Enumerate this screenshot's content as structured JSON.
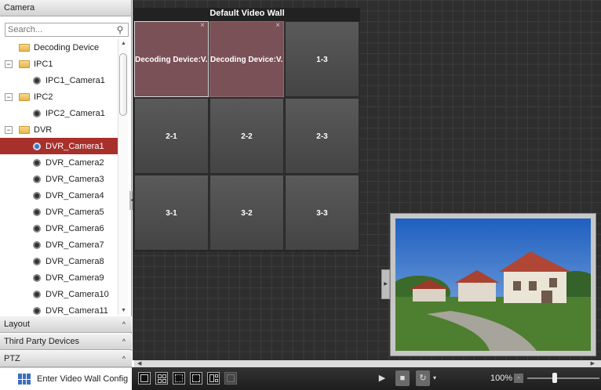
{
  "sidebar": {
    "camera_header": "Camera",
    "search": {
      "placeholder": "Search..."
    },
    "tree": [
      {
        "label": "Decoding Device",
        "kind": "folder",
        "expander": ""
      },
      {
        "label": "IPC1",
        "kind": "folder",
        "expander": "−"
      },
      {
        "label": "IPC1_Camera1",
        "kind": "camera",
        "expander": ""
      },
      {
        "label": "IPC2",
        "kind": "folder",
        "expander": "−"
      },
      {
        "label": "IPC2_Camera1",
        "kind": "camera",
        "expander": ""
      },
      {
        "label": "DVR",
        "kind": "folder",
        "expander": "−"
      },
      {
        "label": "DVR_Camera1",
        "kind": "camera",
        "selected": true
      },
      {
        "label": "DVR_Camera2",
        "kind": "camera"
      },
      {
        "label": "DVR_Camera3",
        "kind": "camera"
      },
      {
        "label": "DVR_Camera4",
        "kind": "camera"
      },
      {
        "label": "DVR_Camera5",
        "kind": "camera"
      },
      {
        "label": "DVR_Camera6",
        "kind": "camera"
      },
      {
        "label": "DVR_Camera7",
        "kind": "camera"
      },
      {
        "label": "DVR_Camera8",
        "kind": "camera"
      },
      {
        "label": "DVR_Camera9",
        "kind": "camera"
      },
      {
        "label": "DVR_Camera10",
        "kind": "camera"
      },
      {
        "label": "DVR_Camera11",
        "kind": "camera"
      }
    ],
    "sections": [
      {
        "label": "Layout",
        "chevron": "^"
      },
      {
        "label": "Third Party Devices",
        "chevron": "^"
      },
      {
        "label": "PTZ",
        "chevron": "^"
      }
    ],
    "config_button": "Enter Video Wall Config"
  },
  "wall": {
    "title": "Default Video Wall",
    "tiles": [
      {
        "label": "Decoding Device:V...",
        "active": true,
        "close": "×"
      },
      {
        "label": "Decoding Device:V...",
        "active": true,
        "close": "×"
      },
      {
        "label": "1-3"
      },
      {
        "label": "2-1"
      },
      {
        "label": "2-2"
      },
      {
        "label": "2-3"
      },
      {
        "label": "3-1"
      },
      {
        "label": "3-2"
      },
      {
        "label": "3-3"
      }
    ]
  },
  "toolbar": {
    "zoom": "100%",
    "zoom_level": 0.38,
    "zoom_minus": "-",
    "play_icon": "play-icon",
    "stop_icon": "stop-icon",
    "refresh_icon": "refresh-icon"
  },
  "colors": {
    "selected_row": "#a8302b",
    "active_tile": "#7a5156",
    "canvas_bg": "#2e2e2e"
  }
}
